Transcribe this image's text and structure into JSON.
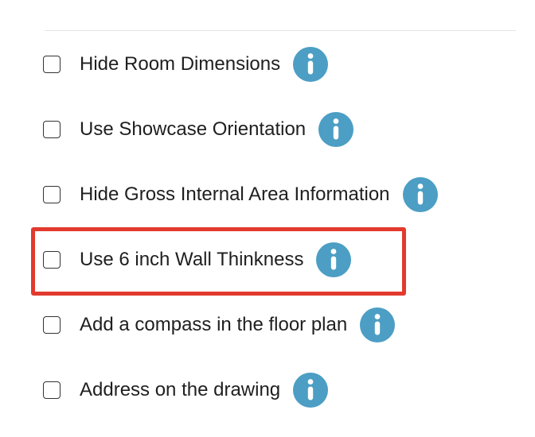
{
  "options": [
    {
      "label": "Hide Room Dimensions",
      "checked": false,
      "info_icon": "info-icon"
    },
    {
      "label": "Use Showcase Orientation",
      "checked": false,
      "info_icon": "info-icon"
    },
    {
      "label": "Hide Gross Internal Area Information",
      "checked": false,
      "info_icon": "info-icon"
    },
    {
      "label": "Use 6 inch Wall Thinkness",
      "checked": false,
      "info_icon": "info-icon"
    },
    {
      "label": "Add a compass in the floor plan",
      "checked": false,
      "info_icon": "info-icon"
    },
    {
      "label": "Address on the drawing",
      "checked": false,
      "info_icon": "info-icon"
    }
  ],
  "highlighted_option": "Use 6 inch Wall Thinkness",
  "colors": {
    "info_icon_background": "#4c9ec4",
    "info_icon_glyph": "#ffffff",
    "highlight_border": "#e23a2e",
    "divider": "#e4e4e4",
    "text": "#1f1f1f"
  }
}
